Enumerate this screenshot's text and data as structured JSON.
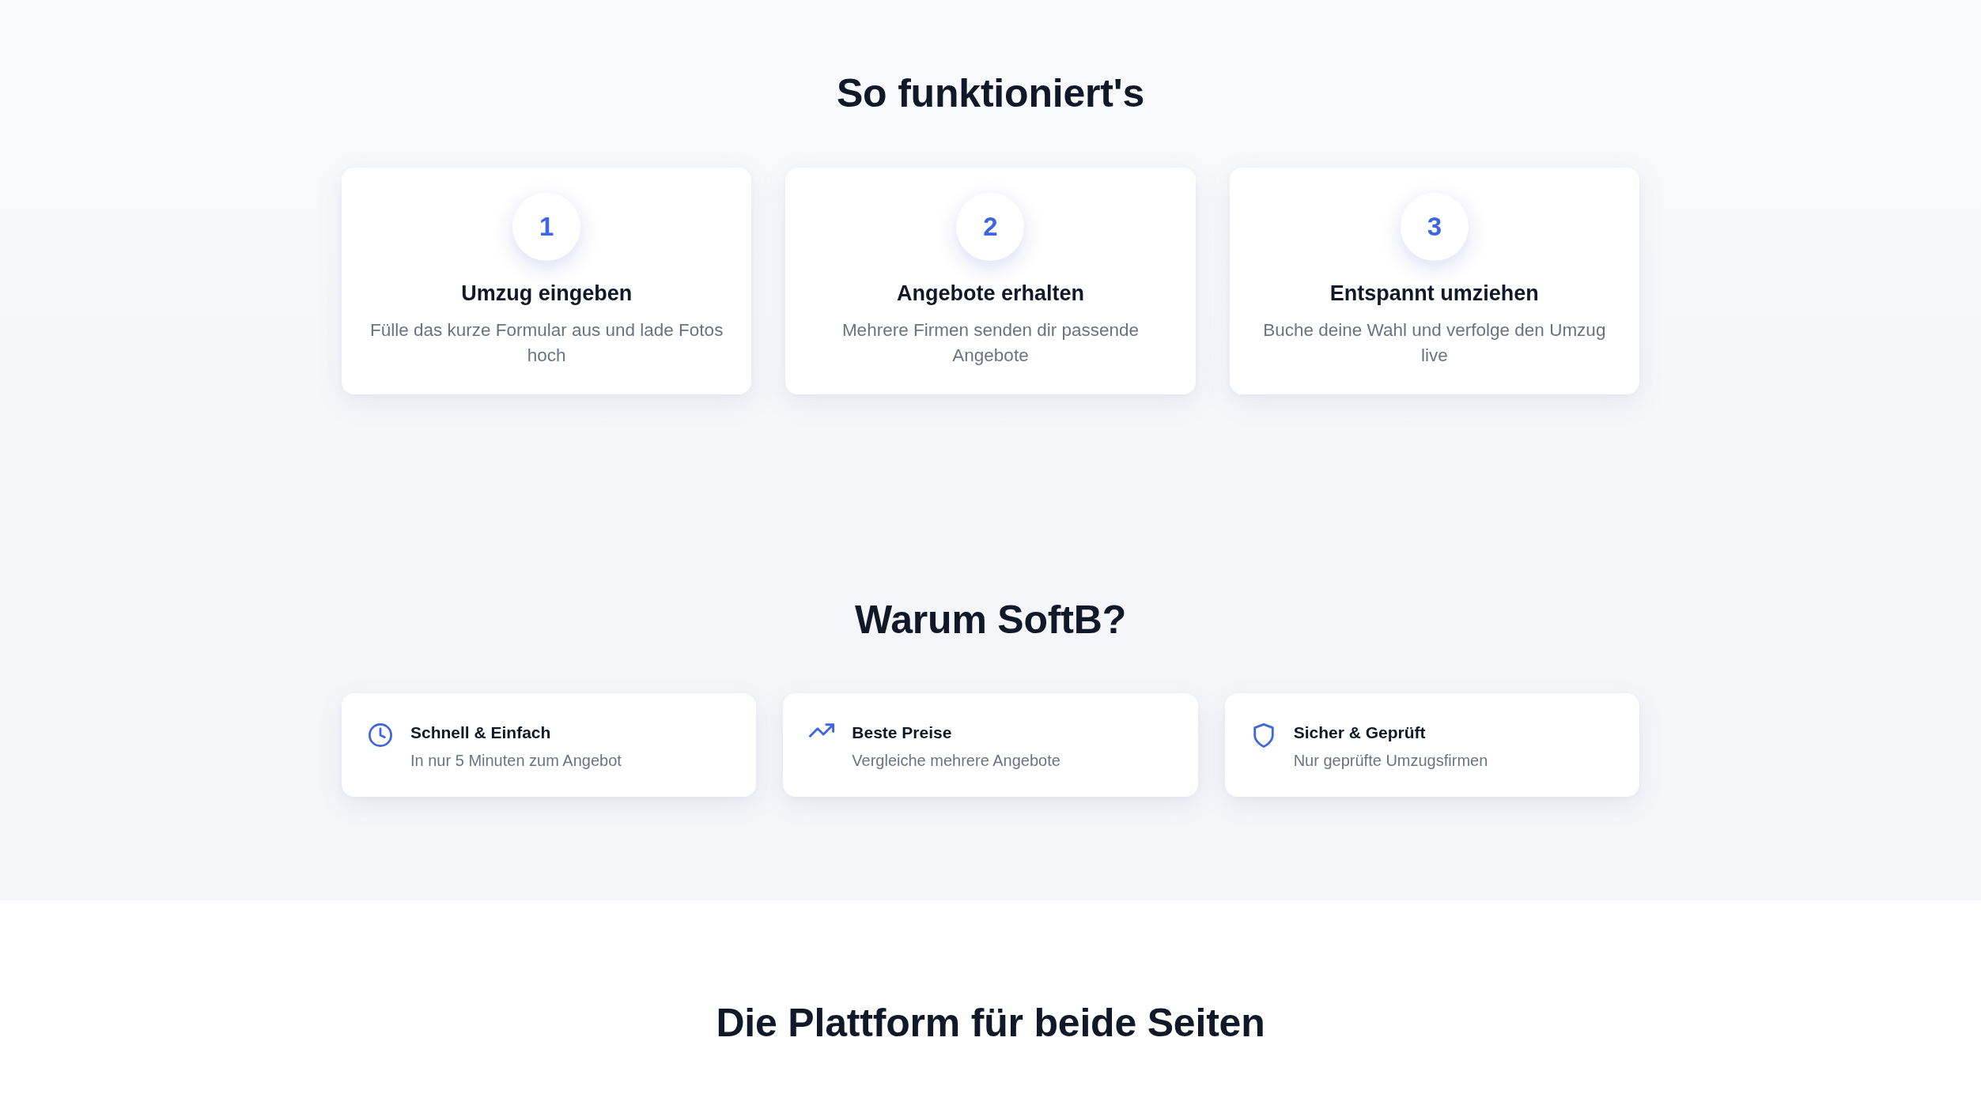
{
  "how_it_works": {
    "title": "So funktioniert's",
    "steps": [
      {
        "number": "1",
        "title": "Umzug eingeben",
        "description": "Fülle das kurze Formular aus und lade Fotos hoch"
      },
      {
        "number": "2",
        "title": "Angebote erhalten",
        "description": "Mehrere Firmen senden dir passende Angebote"
      },
      {
        "number": "3",
        "title": "Entspannt umziehen",
        "description": "Buche deine Wahl und verfolge den Umzug live"
      }
    ]
  },
  "why": {
    "title": "Warum SoftB?",
    "features": [
      {
        "title": "Schnell & Einfach",
        "description": "In nur 5 Minuten zum Angebot"
      },
      {
        "title": "Beste Preise",
        "description": "Vergleiche mehrere Angebote"
      },
      {
        "title": "Sicher & Geprüft",
        "description": "Nur geprüfte Umzugsfirmen"
      }
    ]
  },
  "platform": {
    "title": "Die Plattform für beide Seiten"
  }
}
